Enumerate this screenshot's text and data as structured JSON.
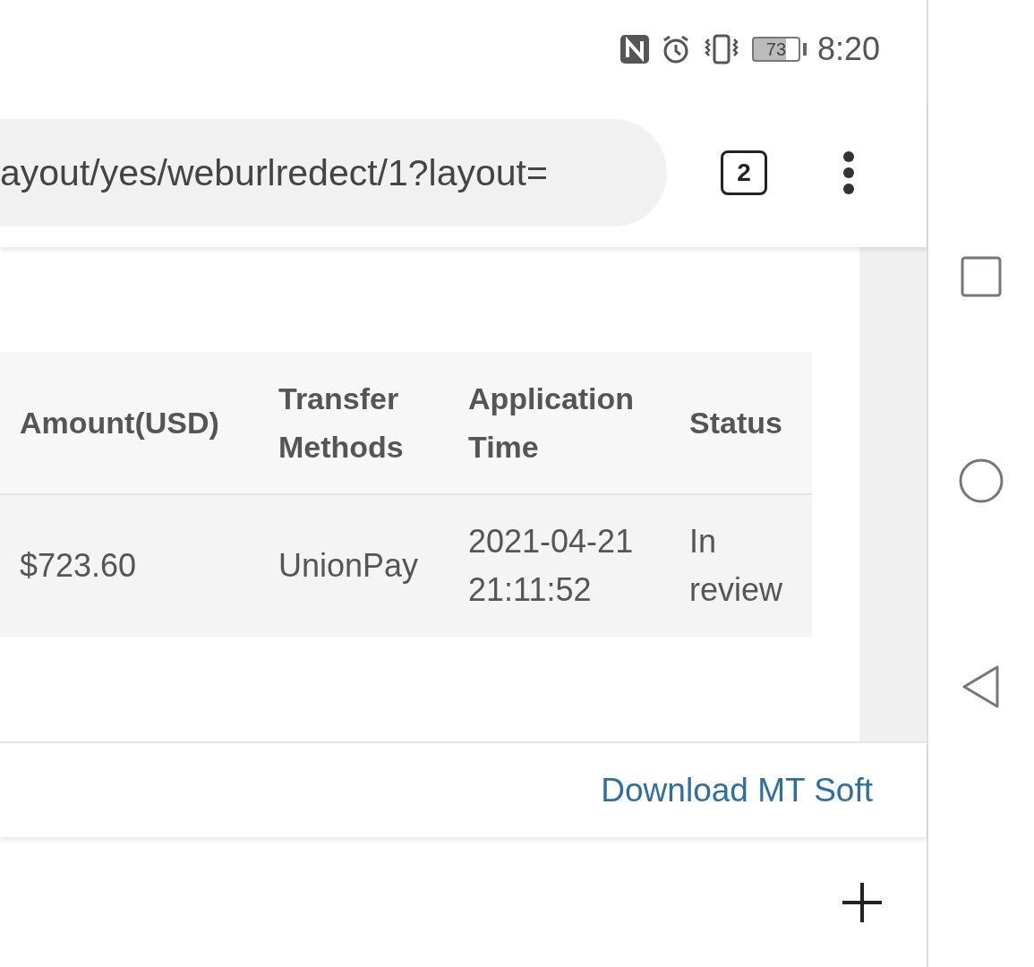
{
  "status_bar": {
    "battery": "73",
    "time": "8:20"
  },
  "browser": {
    "url": "ayout/yes/weburlredect/1?layout=",
    "tab_count": "2"
  },
  "table": {
    "columns": [
      "Amount(USD)",
      "Transfer Methods",
      "Application Time",
      "Status"
    ],
    "rows": [
      [
        "$723.60",
        "UnionPay",
        "2021-04-21 21:11:52",
        "In review"
      ]
    ]
  },
  "footer_link": "Download MT Soft"
}
